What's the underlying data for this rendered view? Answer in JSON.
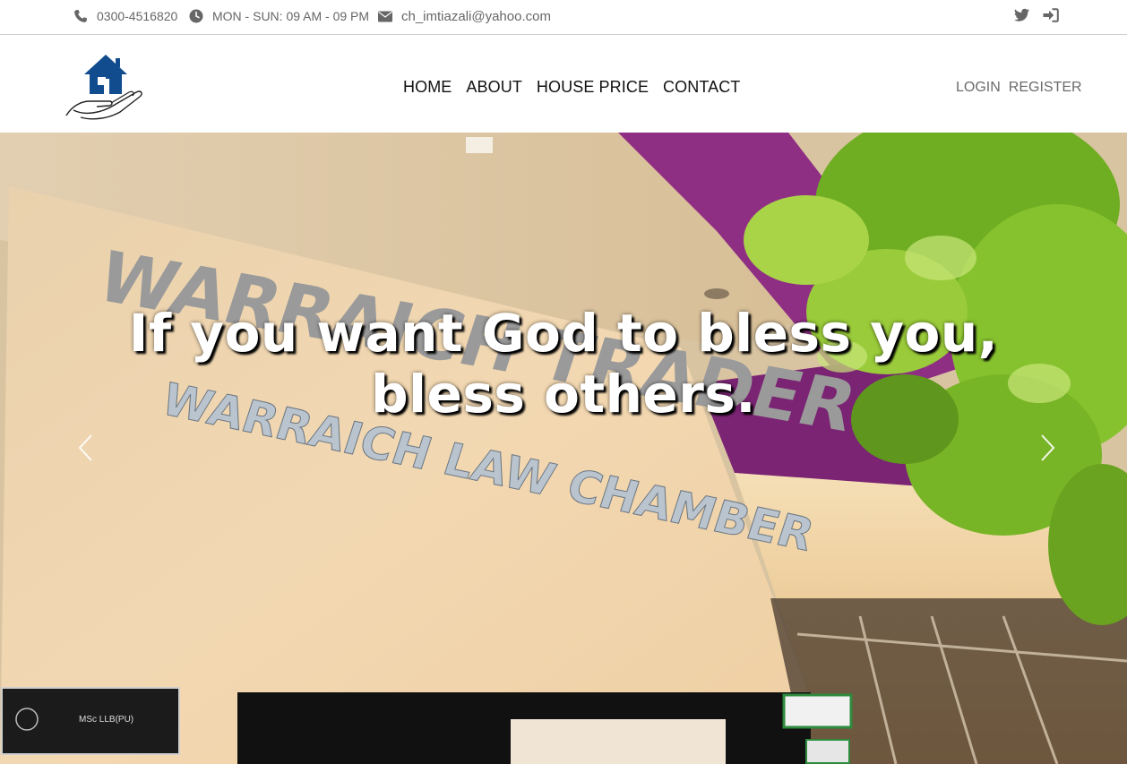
{
  "topbar": {
    "phone": "0300-4516820",
    "hours": "MON - SUN: 09 AM - 09 PM",
    "email": "ch_imtiazali@yahoo.com",
    "social_icons": [
      "twitter-icon",
      "sign-in-icon"
    ]
  },
  "nav": {
    "items": [
      {
        "label": "HOME"
      },
      {
        "label": "ABOUT"
      },
      {
        "label": "HOUSE PRICE"
      },
      {
        "label": "CONTACT"
      }
    ],
    "login": "LOGIN",
    "register": "REGISTER"
  },
  "hero": {
    "line1": "If you want God to bless you,",
    "line2": "bless others.",
    "building_sign_top": "WARRAICH TRADERS",
    "building_sign_bottom": "WARRAICH LAW CHAMBER",
    "nameplate_line1": "MSc LLB(PU)"
  },
  "colors": {
    "logo_blue": "#114c8e",
    "icon_grey": "#666666",
    "wall": "#f0d8b4",
    "purple": "#8f2f84"
  }
}
